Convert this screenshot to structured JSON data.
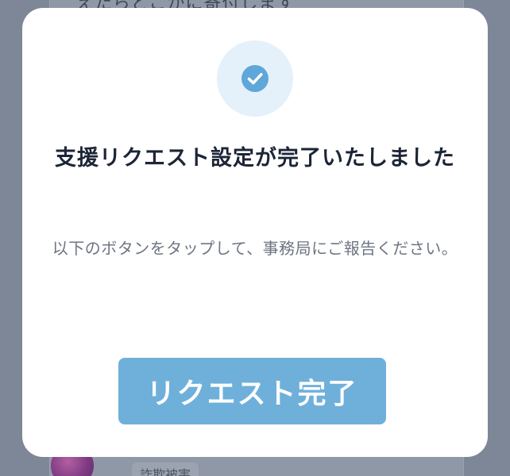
{
  "background": {
    "partial_text": "えたらどこかに寄付します",
    "tag_label": "詐欺被害"
  },
  "modal": {
    "icon": "check-circle-icon",
    "title": "支援リクエスト設定が完了いたしました",
    "description": "以下のボタンをタップして、事務局にご報告ください。",
    "button_label": "リクエスト完了"
  },
  "colors": {
    "accent": "#6fb0db",
    "icon_bg": "#e4f1fb",
    "icon_fg": "#5ea7d8",
    "title": "#1c2536",
    "description": "#6e7582",
    "overlay": "#7d8797"
  }
}
